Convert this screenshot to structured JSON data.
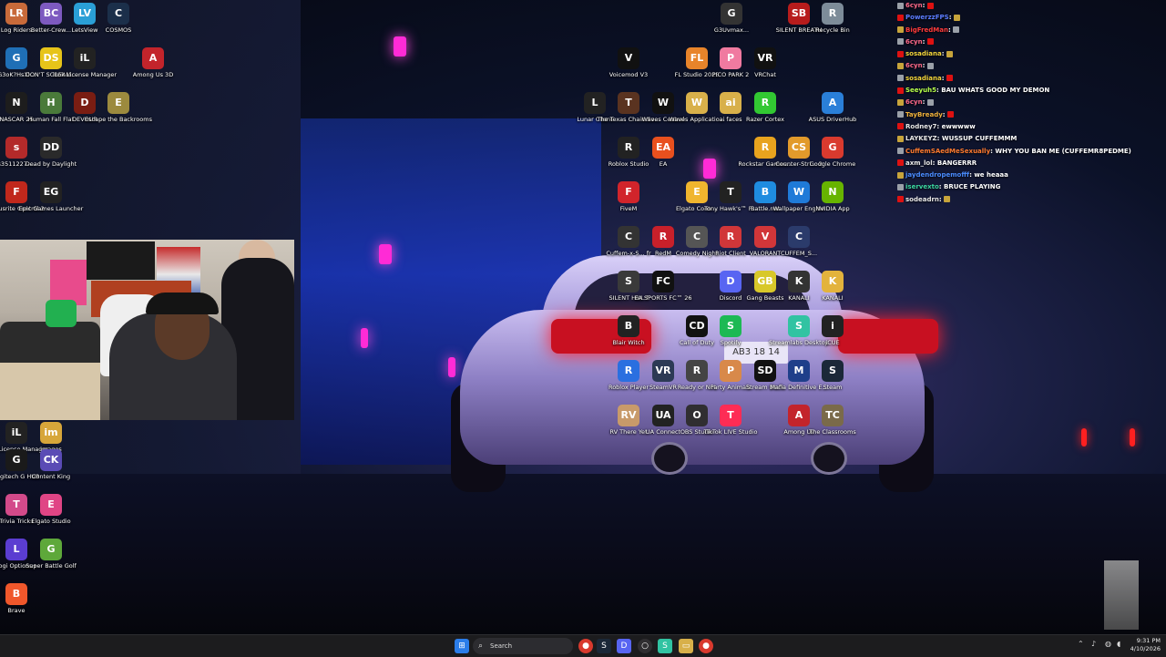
{
  "desktop": {
    "icons": [
      {
        "label": "Log Riders",
        "glyph": "LR",
        "color": "#c86a3a"
      },
      {
        "label": "Better-Crew...",
        "glyph": "BC",
        "color": "#7d5ac0"
      },
      {
        "label": "LetsView",
        "glyph": "LV",
        "color": "#2a9fd6"
      },
      {
        "label": "COSMOS",
        "glyph": "C",
        "color": "#1b2f4a"
      },
      {
        "label": "G3oK?HsXl...",
        "glyph": "G",
        "color": "#1f6fb6"
      },
      {
        "label": "DON'T SCREAM...",
        "glyph": "DS",
        "color": "#e7c419"
      },
      {
        "label": "iLok License Manager",
        "glyph": "iL",
        "color": "#222"
      },
      {
        "label": "Among Us 3D",
        "glyph": "A",
        "color": "#c3242b"
      },
      {
        "label": "NASCAR 25",
        "glyph": "N",
        "color": "#1d1d1d"
      },
      {
        "label": "Human Fall Flat",
        "glyph": "H",
        "color": "#4a7a3a"
      },
      {
        "label": "DEVOUR",
        "glyph": "D",
        "color": "#7a1d12"
      },
      {
        "label": "Escape the Backrooms",
        "glyph": "E",
        "color": "#9c8a3e"
      },
      {
        "label": "s3511227-...",
        "glyph": "s",
        "color": "#b32a2a"
      },
      {
        "label": "Dead by Daylight",
        "glyph": "DD",
        "color": "#2a2a2a"
      },
      {
        "label": "Focusrite Control 2",
        "glyph": "F",
        "color": "#c0281c"
      },
      {
        "label": "Epic Games Launcher",
        "glyph": "EG",
        "color": "#222"
      },
      {
        "label": "iLok License Manager",
        "glyph": "iL",
        "color": "#222"
      },
      {
        "label": "images",
        "glyph": "im",
        "color": "#d7a63a"
      },
      {
        "label": "Logitech G HUB",
        "glyph": "G",
        "color": "#1a1a1a"
      },
      {
        "label": "Content King",
        "glyph": "CK",
        "color": "#5a4bb5"
      },
      {
        "label": "Trivia Tricks",
        "glyph": "T",
        "color": "#d34a8a"
      },
      {
        "label": "Elgato Studio",
        "glyph": "E",
        "color": "#e04585"
      },
      {
        "label": "Logi Options+",
        "glyph": "L",
        "color": "#5b3dd1"
      },
      {
        "label": "Super Battle Golf",
        "glyph": "G",
        "color": "#5ea83a"
      },
      {
        "label": "Brave",
        "glyph": "B",
        "color": "#f0572b"
      },
      {
        "label": "G3Uvmax...",
        "glyph": "G",
        "color": "#333"
      },
      {
        "label": "SILENT BREATH",
        "glyph": "SB",
        "color": "#b71c1c"
      },
      {
        "label": "Recycle Bin",
        "glyph": "R",
        "color": "#7d8c99"
      },
      {
        "label": "Voicemod V3",
        "glyph": "V",
        "color": "#111"
      },
      {
        "label": "FL Studio 2025",
        "glyph": "FL",
        "color": "#e8842a"
      },
      {
        "label": "PICO PARK 2",
        "glyph": "P",
        "color": "#f07aa0"
      },
      {
        "label": "VRChat",
        "glyph": "VR",
        "color": "#111"
      },
      {
        "label": "Lunar Client",
        "glyph": "L",
        "color": "#222"
      },
      {
        "label": "The Texas Chain Sa...",
        "glyph": "T",
        "color": "#5a3320"
      },
      {
        "label": "Waves Central",
        "glyph": "W",
        "color": "#111"
      },
      {
        "label": "Waves Applicatio...",
        "glyph": "W",
        "color": "#d8b04a"
      },
      {
        "label": "ai faces",
        "glyph": "ai",
        "color": "#d8b04a"
      },
      {
        "label": "Razer Cortex",
        "glyph": "R",
        "color": "#32c832"
      },
      {
        "label": "ASUS DriverHub",
        "glyph": "A",
        "color": "#2a7fd8"
      },
      {
        "label": "Roblox Studio",
        "glyph": "R",
        "color": "#222"
      },
      {
        "label": "EA",
        "glyph": "EA",
        "color": "#e8501e"
      },
      {
        "label": "Rockstar Games...",
        "glyph": "R",
        "color": "#e8a31e"
      },
      {
        "label": "Counter-Stri... 2",
        "glyph": "CS",
        "color": "#e29a2b"
      },
      {
        "label": "Google Chrome",
        "glyph": "G",
        "color": "#d93a2e"
      },
      {
        "label": "FiveM",
        "glyph": "F",
        "color": "#d1242b"
      },
      {
        "label": "Elgato Contr...",
        "glyph": "E",
        "color": "#f0b52e"
      },
      {
        "label": "Tony Hawk's™ P...",
        "glyph": "T",
        "color": "#222"
      },
      {
        "label": "Battle.net",
        "glyph": "B",
        "color": "#1f8ce0"
      },
      {
        "label": "Wallpaper Engine",
        "glyph": "W",
        "color": "#1f7ad8"
      },
      {
        "label": "NVIDIA App",
        "glyph": "N",
        "color": "#67b400"
      },
      {
        "label": "Cuffem-x-S... fr",
        "glyph": "C",
        "color": "#333"
      },
      {
        "label": "RedM",
        "glyph": "R",
        "color": "#c8202a"
      },
      {
        "label": "Comedy Night",
        "glyph": "C",
        "color": "#555"
      },
      {
        "label": "Riot Client",
        "glyph": "R",
        "color": "#d13639"
      },
      {
        "label": "VALORANT",
        "glyph": "V",
        "color": "#d13639"
      },
      {
        "label": "CUFFEM_S...",
        "glyph": "C",
        "color": "#2b3b6b"
      },
      {
        "label": "SILENT HILL f",
        "glyph": "S",
        "color": "#3a3a3a"
      },
      {
        "label": "EA SPORTS FC™ 26",
        "glyph": "FC",
        "color": "#111"
      },
      {
        "label": "Discord",
        "glyph": "D",
        "color": "#5865f2"
      },
      {
        "label": "Gang Beasts",
        "glyph": "GB",
        "color": "#d8c82a"
      },
      {
        "label": "KANALI",
        "glyph": "K",
        "color": "#333"
      },
      {
        "label": "KANALI",
        "glyph": "K",
        "color": "#e3b33c"
      },
      {
        "label": "Blair Witch",
        "glyph": "B",
        "color": "#222"
      },
      {
        "label": "Call of Duty",
        "glyph": "CD",
        "color": "#111"
      },
      {
        "label": "Spotify",
        "glyph": "S",
        "color": "#1db954"
      },
      {
        "label": "Streamlabs Desktop",
        "glyph": "S",
        "color": "#31c3a2"
      },
      {
        "label": "iCUE",
        "glyph": "i",
        "color": "#222"
      },
      {
        "label": "Roblox Player",
        "glyph": "R",
        "color": "#2a6fe0"
      },
      {
        "label": "SteamVR",
        "glyph": "VR",
        "color": "#2c3a55"
      },
      {
        "label": "Ready or Not",
        "glyph": "R",
        "color": "#444"
      },
      {
        "label": "Party Animals",
        "glyph": "P",
        "color": "#d8894a"
      },
      {
        "label": "Stream Deck",
        "glyph": "SD",
        "color": "#111"
      },
      {
        "label": "Mafia Definitive E...",
        "glyph": "M",
        "color": "#1f3f8a"
      },
      {
        "label": "Steam",
        "glyph": "S",
        "color": "#1b2838"
      },
      {
        "label": "RV There Yet",
        "glyph": "RV",
        "color": "#c89a6a"
      },
      {
        "label": "UA Connect",
        "glyph": "UA",
        "color": "#222"
      },
      {
        "label": "OBS Studio",
        "glyph": "O",
        "color": "#302e31"
      },
      {
        "label": "TikTok LIVE Studio",
        "glyph": "T",
        "color": "#fe2c55"
      },
      {
        "label": "Among Us",
        "glyph": "A",
        "color": "#c3242b"
      },
      {
        "label": "The Classrooms",
        "glyph": "TC",
        "color": "#7a6a4a"
      }
    ]
  },
  "car": {
    "plate": "AB3 18 14"
  },
  "chat": {
    "messages": [
      {
        "user": "6cyn",
        "user_color": "#ff6a8a",
        "text": ""
      },
      {
        "user": "PowerzzFPS",
        "user_color": "#5b7cff",
        "text": ""
      },
      {
        "user": "BigFredMan",
        "user_color": "#ff3b3b",
        "text": ""
      },
      {
        "user": "6cyn",
        "user_color": "#ff6a8a",
        "text": ""
      },
      {
        "user": "sosadiana",
        "user_color": "#f2d43b",
        "text": ""
      },
      {
        "user": "6cyn",
        "user_color": "#ff6a8a",
        "text": ""
      },
      {
        "user": "sosadiana",
        "user_color": "#f2d43b",
        "text": ""
      },
      {
        "user": "Seeyuh5",
        "user_color": "#b6ff4a",
        "text": "BAU WHATS GOOD MY DEMON"
      },
      {
        "user": "6cyn",
        "user_color": "#ff6a8a",
        "text": ""
      },
      {
        "user": "TayBready",
        "user_color": "#f0b13b",
        "text": ""
      },
      {
        "user": "Rodney7",
        "user_color": "#e8e8e8",
        "text": "ewwwww"
      },
      {
        "user": "LAYKEYZ",
        "user_color": "#e8e8e8",
        "text": "WUSSUP CUFFEMMM"
      },
      {
        "user": "CuffemSAedMeSexually",
        "user_color": "#ff7a2e",
        "text": "WHY YOU BAN ME (CUFFEMR8PEDME)"
      },
      {
        "user": "axm_lol",
        "user_color": "#e8e8e8",
        "text": "BANGERRR"
      },
      {
        "user": "jaydendropemofff",
        "user_color": "#4a8cff",
        "text": "we heaaa"
      },
      {
        "user": "iservexto",
        "user_color": "#3bd6a0",
        "text": "BRUCE PLAYING"
      },
      {
        "user": "sodeadrn",
        "user_color": "#e8e8e8",
        "text": ""
      }
    ]
  },
  "taskbar": {
    "search_label": "Search",
    "time": "9:31 PM",
    "date": "4/10/2026"
  }
}
